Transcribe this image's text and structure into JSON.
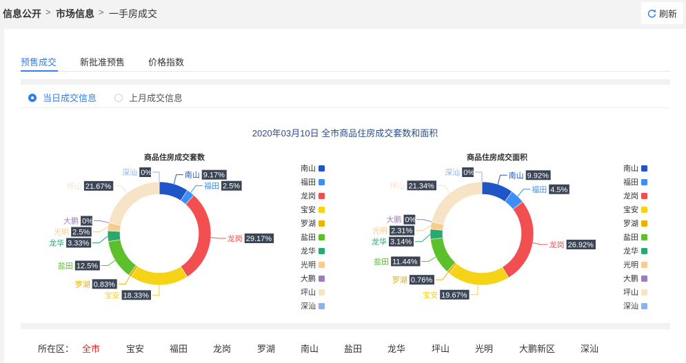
{
  "breadcrumb": [
    "信息公开",
    "市场信息",
    "一手房成交"
  ],
  "refresh_label": "刷新",
  "tabs": [
    "预售成交",
    "新批准预售",
    "价格指数"
  ],
  "radios": [
    "当日成交信息",
    "上月成交信息"
  ],
  "main_title": "2020年03月10日 全市商品住房成交套数和面积",
  "district_filter": {
    "label": "所在区：",
    "options": [
      "全市",
      "宝安",
      "福田",
      "龙岗",
      "罗湖",
      "南山",
      "盐田",
      "龙华",
      "坪山",
      "光明",
      "大鹏新区",
      "深汕"
    ],
    "selected": "全市"
  },
  "colors": {
    "南山": "#1f55c7",
    "福田": "#3d8ef5",
    "龙岗": "#f25050",
    "宝安": "#f5d417",
    "罗湖": "#f0b000",
    "盐田": "#5cc02c",
    "龙华": "#2aa86e",
    "光明": "#f7cc8e",
    "大鹏": "#9b7fb8",
    "坪山": "#f7e3c5",
    "深汕": "#8fb1ea"
  },
  "chart_data": [
    {
      "type": "pie",
      "title": "商品住房成交套数",
      "categories": [
        "南山",
        "福田",
        "龙岗",
        "宝安",
        "罗湖",
        "盐田",
        "龙华",
        "光明",
        "大鹏",
        "坪山",
        "深汕"
      ],
      "values": [
        9.17,
        2.5,
        29.17,
        18.33,
        0.83,
        12.5,
        3.33,
        2.5,
        0,
        21.67,
        0
      ],
      "labels": [
        "9.17%",
        "2.5%",
        "29.17%",
        "18.33%",
        "0.83%",
        "12.5%",
        "3.33%",
        "2.5%",
        "0%",
        "21.67%",
        "0%"
      ],
      "legend": [
        "南山",
        "福田",
        "龙岗",
        "宝安",
        "罗湖",
        "盐田",
        "龙华",
        "光明",
        "大鹏",
        "坪山",
        "深汕"
      ],
      "legend_position": "right"
    },
    {
      "type": "pie",
      "title": "商品住房成交面积",
      "categories": [
        "南山",
        "福田",
        "龙岗",
        "宝安",
        "罗湖",
        "盐田",
        "龙华",
        "光明",
        "大鹏",
        "坪山",
        "深汕"
      ],
      "values": [
        9.92,
        4.5,
        26.92,
        19.67,
        0.76,
        11.44,
        3.14,
        2.31,
        0,
        21.34,
        0
      ],
      "labels": [
        "9.92%",
        "4.5%",
        "26.92%",
        "19.67%",
        "0.76%",
        "11.44%",
        "3.14%",
        "2.31%",
        "0%",
        "21.34%",
        "0%"
      ],
      "legend": [
        "南山",
        "福田",
        "龙岗",
        "宝安",
        "罗湖",
        "盐田",
        "龙华",
        "光明",
        "大鹏",
        "坪山",
        "深汕"
      ],
      "legend_position": "right"
    }
  ]
}
